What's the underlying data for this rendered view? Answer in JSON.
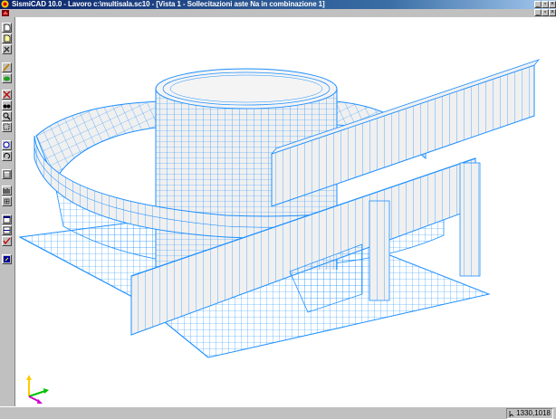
{
  "window": {
    "title": "SismiCAD 10.0 - Lavoro c:\\multisala.sc10 - [Vista 1 - Sollecitazioni aste Na in combinazione 1]",
    "controls": [
      "minimize",
      "maximize",
      "close"
    ]
  },
  "menubar": {
    "icon": "sismicad-icon"
  },
  "toolbar": {
    "buttons": [
      "new-file-icon",
      "open-file-icon",
      "tools-icon",
      "pencil-icon",
      "layers-icon",
      "cross-icon",
      "binoculars-icon",
      "zoom-icon",
      "zoom-window-icon",
      "zoom-all-icon",
      "rotate-icon",
      "table-icon",
      "bars-icon",
      "grid-icon",
      "window-icon",
      "window-split-icon",
      "check-icon",
      "export-icon"
    ]
  },
  "viewport": {
    "wireframe_color": "#1e90ff",
    "surface_color": "#f0f0f0",
    "axes": [
      "x-axis",
      "y-axis",
      "z-axis"
    ]
  },
  "statusbar": {
    "coordinates": "1330,1018"
  },
  "colors": {
    "title_start": "#0a246a",
    "title_end": "#a6caf0",
    "chrome": "#c0c0c0"
  }
}
